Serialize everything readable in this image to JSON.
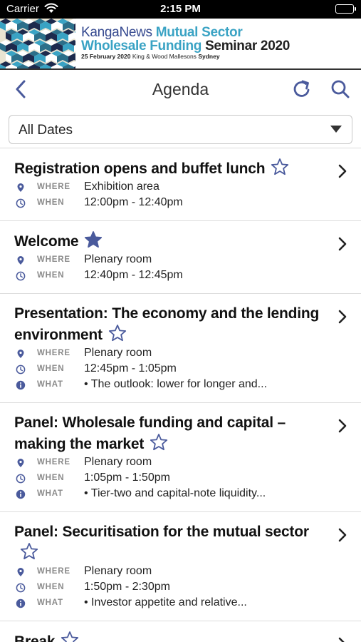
{
  "status_bar": {
    "carrier": "Carrier",
    "time": "2:15 PM"
  },
  "banner": {
    "brand": "KangaNews",
    "event_line1_accent": "Mutual Sector",
    "event_line2_accent": "Wholesale Funding",
    "event_line2_rest": "Seminar 2020",
    "date": "25 February 2020",
    "venue": "King & Wood Mallesons",
    "city": "Sydney",
    "colors": {
      "navy": "#34488f",
      "teal": "#3aa3c4"
    }
  },
  "navbar": {
    "title": "Agenda",
    "back_icon": "chevron-left-icon",
    "refresh_icon": "refresh-icon",
    "search_icon": "search-icon"
  },
  "filter": {
    "selected": "All Dates"
  },
  "labels": {
    "where": "WHERE",
    "when": "WHEN",
    "what": "WHAT"
  },
  "accent_color": "#4a5a9c",
  "items": [
    {
      "title": "Registration opens and buffet lunch",
      "favourite": false,
      "where": "Exhibition area",
      "when": "12:00pm - 12:40pm"
    },
    {
      "title": "Welcome",
      "favourite": true,
      "where": "Plenary room",
      "when": "12:40pm - 12:45pm"
    },
    {
      "title": "Presentation: The economy and the lending environment",
      "favourite": false,
      "where": "Plenary room",
      "when": "12:45pm - 1:05pm",
      "what": "• The outlook: lower for longer and..."
    },
    {
      "title": "Panel: Wholesale funding and capital – making the market",
      "favourite": false,
      "where": "Plenary room",
      "when": "1:05pm - 1:50pm",
      "what": "• Tier-two and capital-note liquidity..."
    },
    {
      "title": "Panel: Securitisation for the mutual sector",
      "favourite": false,
      "where": "Plenary room",
      "when": "1:50pm - 2:30pm",
      "what": "• Investor appetite and relative..."
    },
    {
      "title": "Break",
      "favourite": false
    }
  ]
}
